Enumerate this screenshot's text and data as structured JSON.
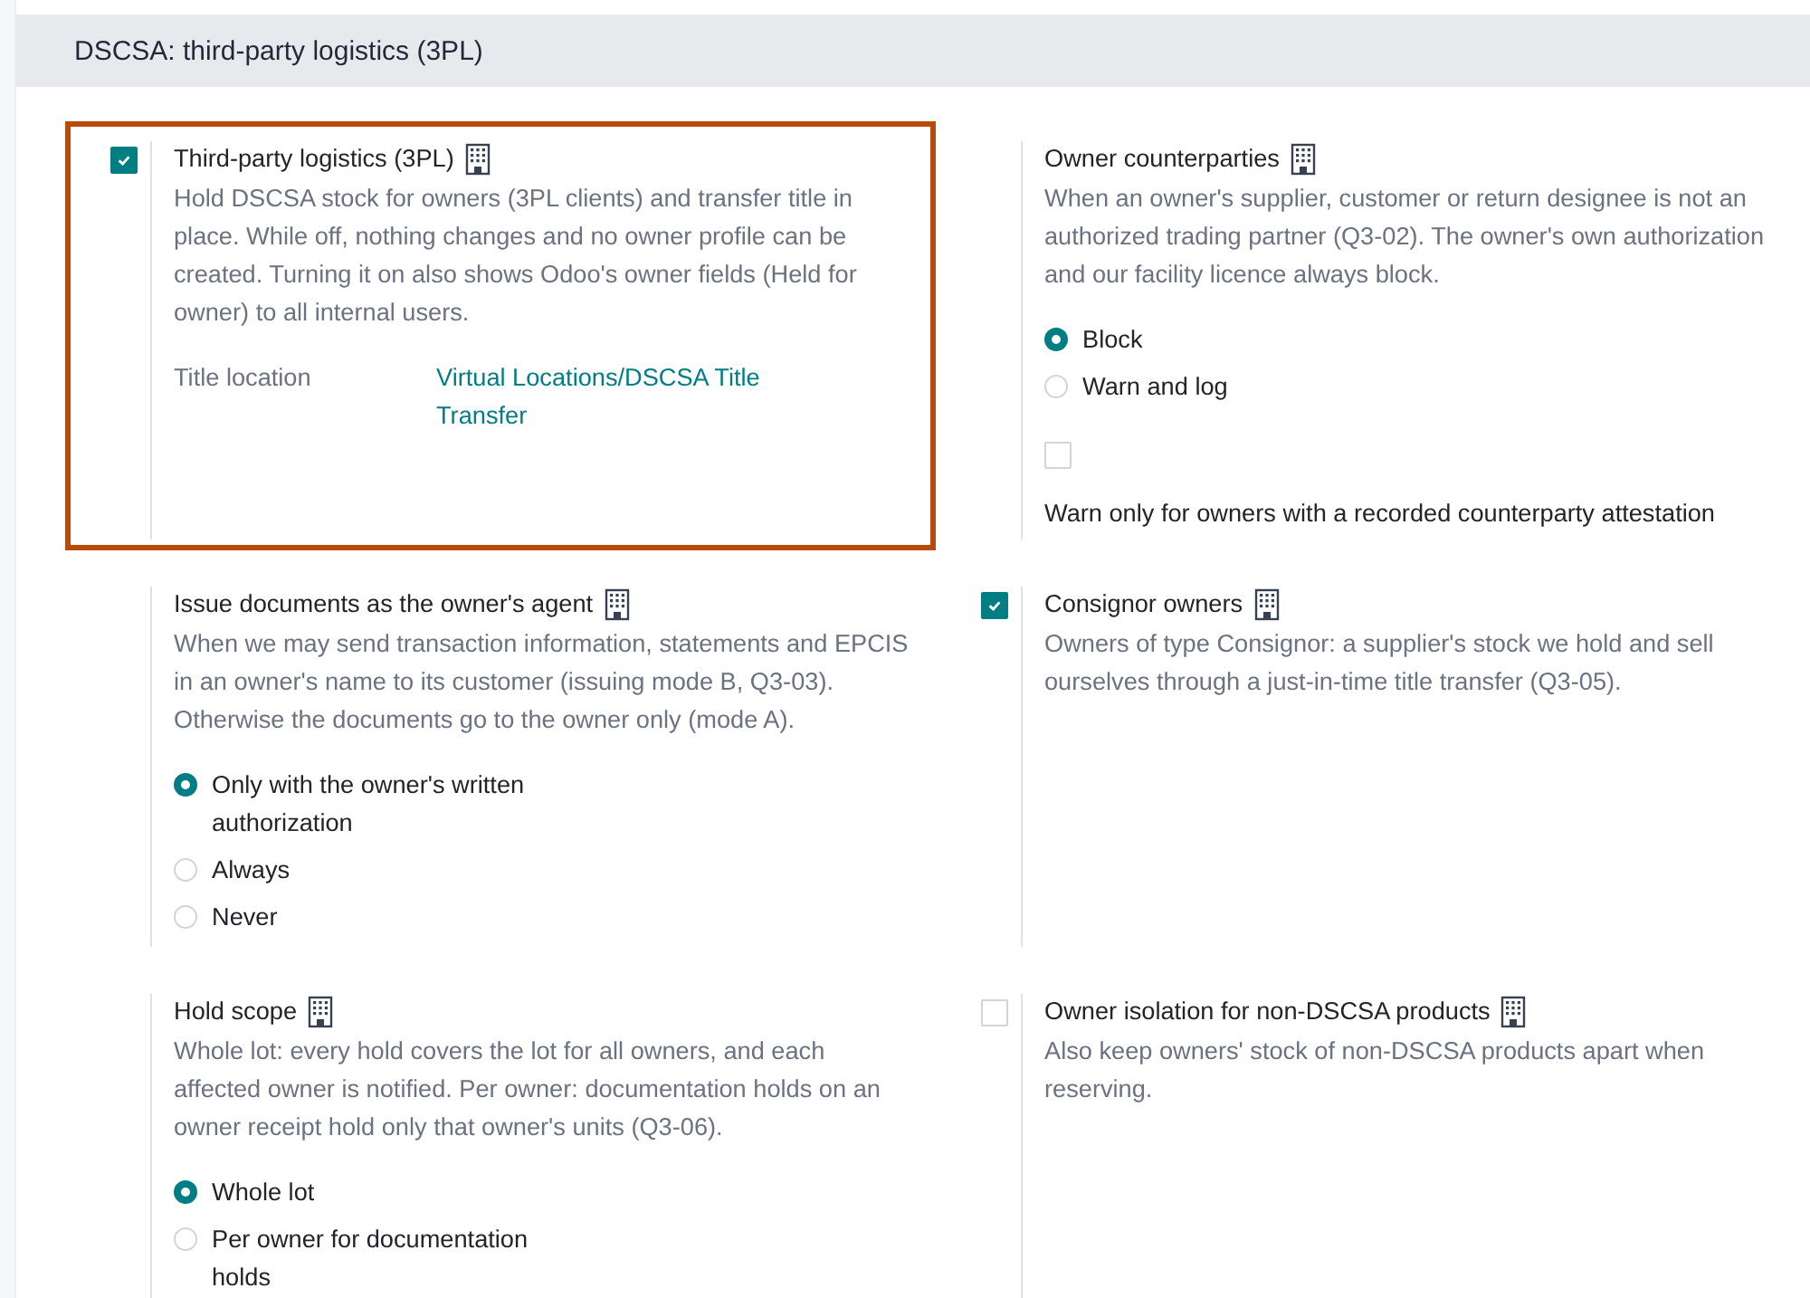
{
  "section": {
    "title": "DSCSA: third-party logistics (3PL)"
  },
  "settings": [
    {
      "kind": "toggle",
      "checked": true,
      "highlighted": true,
      "title": "Third-party logistics (3PL)",
      "description": "Hold DSCSA stock for owners (3PL clients) and transfer title in place. While off, nothing changes and no owner profile can be created. Turning it on also shows Odoo's owner fields (Held for owner) to all internal users.",
      "fields": [
        {
          "label": "Title location",
          "value": "Virtual Locations/DSCSA Title Transfer"
        }
      ]
    },
    {
      "kind": "plain",
      "highlighted": false,
      "title": "Owner counterparties",
      "description": "When an owner's supplier, customer or return designee is not an authorized trading partner (Q3-02). The owner's own authorization and our facility licence always block.",
      "radios": [
        {
          "label": "Block",
          "selected": true
        },
        {
          "label": "Warn and log",
          "selected": false
        }
      ],
      "option": {
        "checked": false,
        "label": "Warn only for owners with a recorded counterparty attestation"
      }
    },
    {
      "kind": "plain",
      "highlighted": false,
      "title": "Issue documents as the owner's agent",
      "description": "When we may send transaction information, statements and EPCIS in an owner's name to its customer (issuing mode B, Q3-03). Otherwise the documents go to the owner only (mode A).",
      "radios": [
        {
          "label": "Only with the owner's written authorization",
          "selected": true
        },
        {
          "label": "Always",
          "selected": false
        },
        {
          "label": "Never",
          "selected": false
        }
      ]
    },
    {
      "kind": "toggle",
      "checked": true,
      "highlighted": false,
      "title": "Consignor owners",
      "description": "Owners of type Consignor: a supplier's stock we hold and sell ourselves through a just-in-time title transfer (Q3-05)."
    },
    {
      "kind": "plain",
      "highlighted": false,
      "title": "Hold scope",
      "description": "Whole lot: every hold covers the lot for all owners, and each affected owner is notified. Per owner: documentation holds on an owner receipt hold only that owner's units (Q3-06).",
      "radios": [
        {
          "label": "Whole lot",
          "selected": true
        },
        {
          "label": "Per owner for documentation holds",
          "selected": false
        }
      ]
    },
    {
      "kind": "toggle",
      "checked": false,
      "highlighted": false,
      "title": "Owner isolation for non-DSCSA products",
      "description": "Also keep owners' stock of non-DSCSA products apart when reserving."
    }
  ]
}
